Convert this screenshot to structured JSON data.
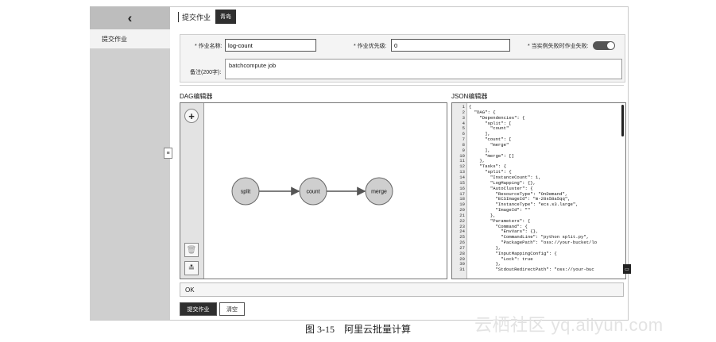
{
  "sidebar": {
    "back_glyph": "‹",
    "item": "提交作业",
    "handle_glyph": "≡"
  },
  "topbar": {
    "title": "提交作业",
    "badge": "青岛"
  },
  "form": {
    "job_name_label": "* 作业名称:",
    "job_name_value": "log-count",
    "priority_label": "* 作业优先级:",
    "priority_value": "0",
    "fail_label": "* 当实例失败时作业失败:",
    "fail_toggle_on": true,
    "note_label": "备注(200字):",
    "note_value": "batchcompute job"
  },
  "dag_editor": {
    "title": "DAG编辑器",
    "tools": {
      "add": "+",
      "delete": "🗑",
      "layout": "≛"
    },
    "nodes": [
      {
        "id": "split",
        "label": "split"
      },
      {
        "id": "count",
        "label": "count"
      },
      {
        "id": "merge",
        "label": "merge"
      }
    ],
    "edges": [
      [
        "split",
        "count"
      ],
      [
        "count",
        "merge"
      ]
    ]
  },
  "json_editor": {
    "title": "JSON编辑器",
    "lines": [
      "{",
      "  \"DAG\": {",
      "    \"Dependencies\": {",
      "      \"split\": [",
      "        \"count\"",
      "      ],",
      "      \"count\": [",
      "        \"merge\"",
      "      ],",
      "      \"merge\": []",
      "    },",
      "    \"Tasks\": {",
      "      \"split\": {",
      "        \"InstanceCount\": 1,",
      "        \"LogMapping\": {},",
      "        \"AutoCluster\": {",
      "          \"ResourceType\": \"OnDemand\",",
      "          \"ECSImageId\": \"m-28s58a5qq\",",
      "          \"InstanceType\": \"ecs.s3.large\",",
      "          \"ImageId\": \"\"",
      "        },",
      "        \"Parameters\": {",
      "          \"Command\": {",
      "            \"EnvVars\": {},",
      "            \"CommandLine\": \"python split.py\",",
      "            \"PackagePath\": \"oss://your-bucket/lo",
      "          },",
      "          \"InputMappingConfig\": {",
      "            \"Lock\": true",
      "          },",
      "          \"StdoutRedirectPath\": \"oss://your-buc"
    ]
  },
  "status": "OK",
  "buttons": {
    "submit": "提交作业",
    "clear": "清空"
  },
  "caption": "图 3-15　阿里云批量计算",
  "watermark": "云栖社区 yq.aliyun.com"
}
